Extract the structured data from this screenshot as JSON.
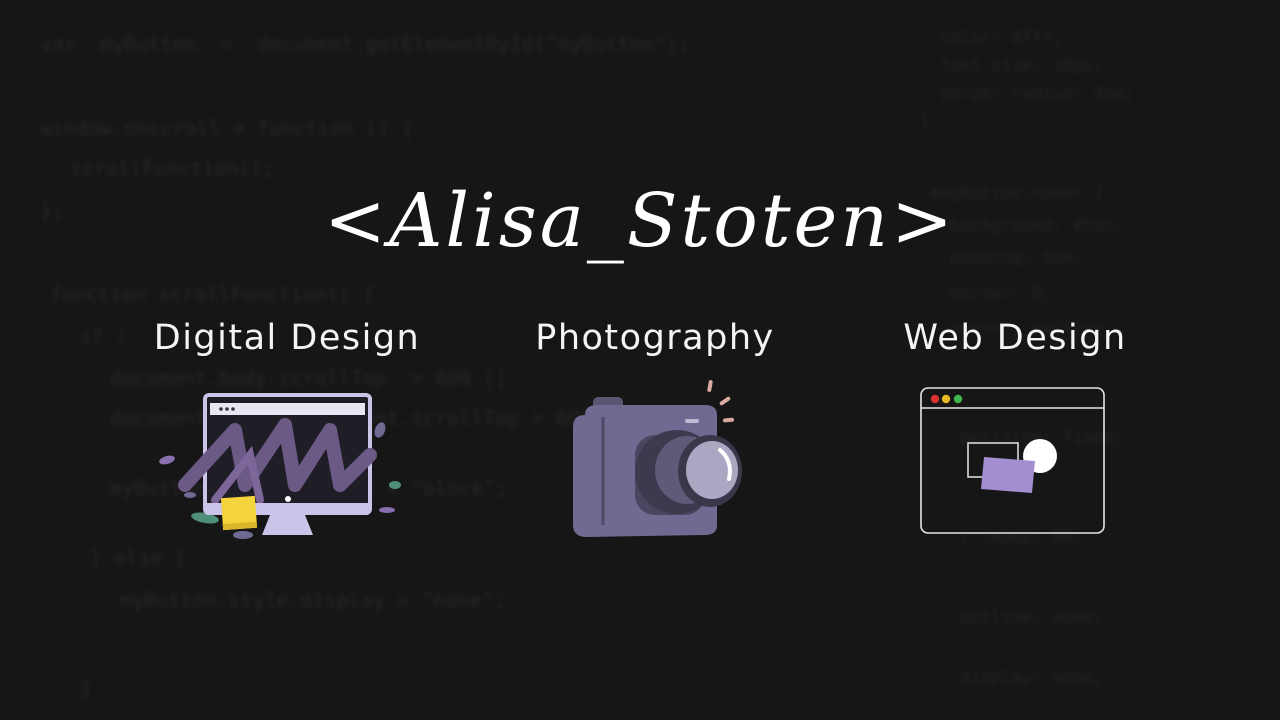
{
  "brand": {
    "title": "<Alisa_Stoten>"
  },
  "services": [
    {
      "label": "Digital Design",
      "icon": "computer-monitor-art-icon"
    },
    {
      "label": "Photography",
      "icon": "camera-icon"
    },
    {
      "label": "Web Design",
      "icon": "browser-window-icon"
    }
  ],
  "colors": {
    "background": "#161616",
    "text": "#ffffff",
    "accent_purple": "#6e6a92",
    "accent_lavender": "#a38fd0",
    "sticky_note": "#f5d33d"
  }
}
